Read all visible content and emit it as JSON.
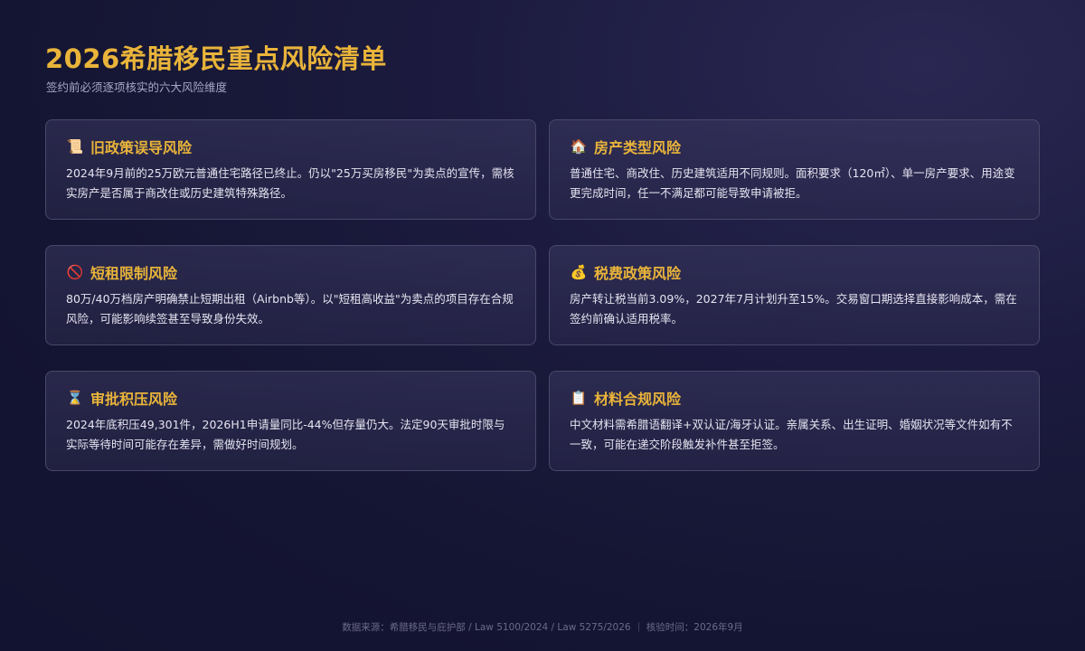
{
  "header": {
    "title": "2026希腊移民重点风险清单",
    "subtitle": "签约前必须逐项核实的六大风险维度"
  },
  "cards": [
    {
      "icon": "📜",
      "icon_name": "scroll-icon",
      "title": "旧政策误导风险",
      "text": "2024年9月前的25万欧元普通住宅路径已终止。仍以\"25万买房移民\"为卖点的宣传，需核实房产是否属于商改住或历史建筑特殊路径。"
    },
    {
      "icon": "🏠",
      "icon_name": "house-icon",
      "title": "房产类型风险",
      "text": "普通住宅、商改住、历史建筑适用不同规则。面积要求（120㎡）、单一房产要求、用途变更完成时间，任一不满足都可能导致申请被拒。"
    },
    {
      "icon": "🚫",
      "icon_name": "prohibited-icon",
      "title": "短租限制风险",
      "text": "80万/40万档房产明确禁止短期出租（Airbnb等）。以\"短租高收益\"为卖点的项目存在合规风险，可能影响续签甚至导致身份失效。"
    },
    {
      "icon": "💰",
      "icon_name": "money-bag-icon",
      "title": "税费政策风险",
      "text": "房产转让税当前3.09%，2027年7月计划升至15%。交易窗口期选择直接影响成本，需在签约前确认适用税率。"
    },
    {
      "icon": "⌛",
      "icon_name": "hourglass-icon",
      "title": "审批积压风险",
      "text": "2024年底积压49,301件，2026H1申请量同比-44%但存量仍大。法定90天审批时限与实际等待时间可能存在差异，需做好时间规划。"
    },
    {
      "icon": "📋",
      "icon_name": "clipboard-icon",
      "title": "材料合规风险",
      "text": "中文材料需希腊语翻译+双认证/海牙认证。亲属关系、出生证明、婚姻状况等文件如有不一致，可能在递交阶段触发补件甚至拒签。"
    }
  ],
  "footer": {
    "text": "数据来源：希腊移民与庇护部 / Law 5100/2024 / Law 5275/2026 ｜ 核验时间：2026年9月"
  },
  "colors": {
    "accent": "#e9b43a",
    "background": "#1c1b3f",
    "card_border": "#4a4868"
  }
}
